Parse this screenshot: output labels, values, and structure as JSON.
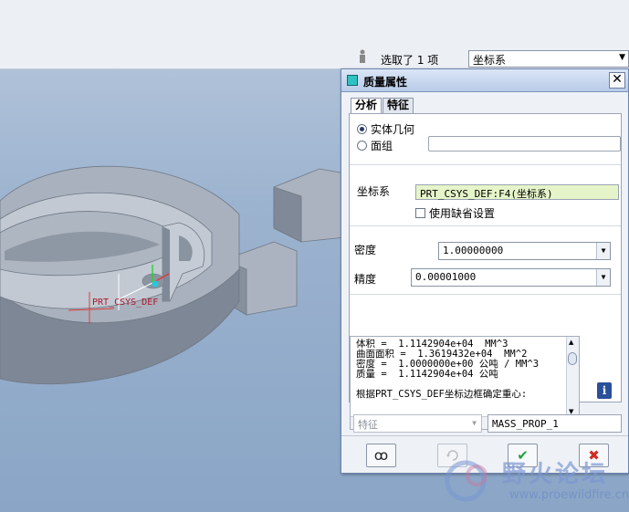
{
  "selection": {
    "text": "选取了 1 项",
    "filter_value": "坐标系",
    "filter_icon": "person-filter-icon"
  },
  "viewport": {
    "csys_label": "PRT_CSYS_DEF"
  },
  "dialog": {
    "title": "质量属性",
    "tabs": [
      "分析",
      "特征"
    ],
    "radio_solid": "实体几何",
    "radio_quilt": "面组",
    "csys_label": "坐标系",
    "csys_value": "PRT_CSYS_DEF:F4(坐标系)",
    "use_default": "使用缺省设置",
    "density_label": "密度",
    "density_value": "1.00000000",
    "accuracy_label": "精度",
    "accuracy_value": "0.00001000",
    "results": [
      "体积 =  1.1142904e+04  MM^3",
      "曲面面积 =  1.3619432e+04  MM^2",
      "密度 =  1.0000000e+00 公吨 / MM^3",
      "质量 =  1.1142904e+04 公吨",
      "",
      "根据PRT_CSYS_DEF坐标边框确定重心:"
    ],
    "feature_combo": "特征",
    "feature_name": "MASS_PROP_1",
    "close_symbol": "✕",
    "preview_symbol": "ꝏ",
    "ok_symbol": "✔",
    "cancel_symbol": "✖",
    "info_symbol": "i"
  },
  "watermark": {
    "text": "野火论坛",
    "url": "www.proewildfire.cn"
  },
  "colors": {
    "accent": "#2a4f9b",
    "csys_field_bg": "#e6f5c9",
    "ok": "#23a23a",
    "cancel": "#d02b22",
    "model": "#9aa6b4"
  }
}
